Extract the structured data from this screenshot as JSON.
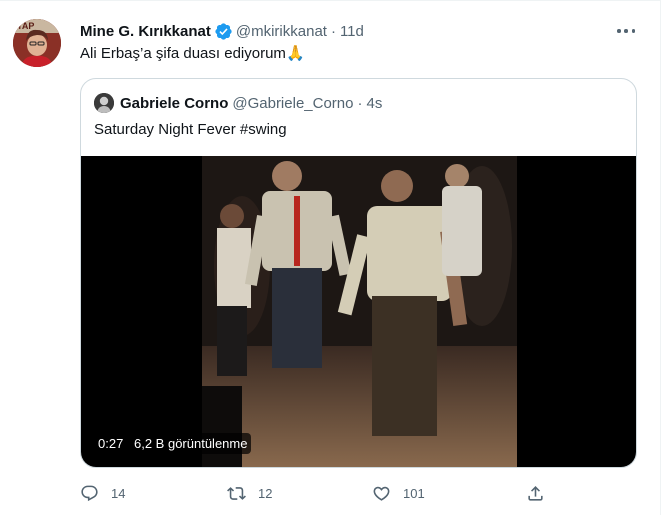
{
  "tweet": {
    "author_name": "Mine G. Kırıkkanat",
    "author_handle": "@mkirikkanat",
    "separator": "·",
    "time": "11d",
    "text": "Ali Erbaş’a şifa duası ediyorum",
    "emoji": "🙏",
    "avatar_icon": "avatar-image",
    "verified_icon": "verified-badge-icon",
    "verified_color": "#1d9bf0",
    "more_icon": "more-options-icon"
  },
  "quoted_tweet": {
    "author_name": "Gabriele Corno",
    "author_handle": "@Gabriele_Corno",
    "separator": "·",
    "time": "4s",
    "text": "Saturday Night Fever #swing",
    "video": {
      "duration": "0:27",
      "views": "6,2 B görüntülenme"
    }
  },
  "actions": {
    "reply_count": "14",
    "retweet_count": "12",
    "like_count": "101",
    "reply_icon": "reply-icon",
    "retweet_icon": "retweet-icon",
    "like_icon": "heart-icon",
    "share_icon": "share-icon"
  },
  "colors": {
    "text_primary": "#0f1419",
    "text_secondary": "#536471",
    "border": "#cfd9de",
    "verified": "#1d9bf0"
  }
}
